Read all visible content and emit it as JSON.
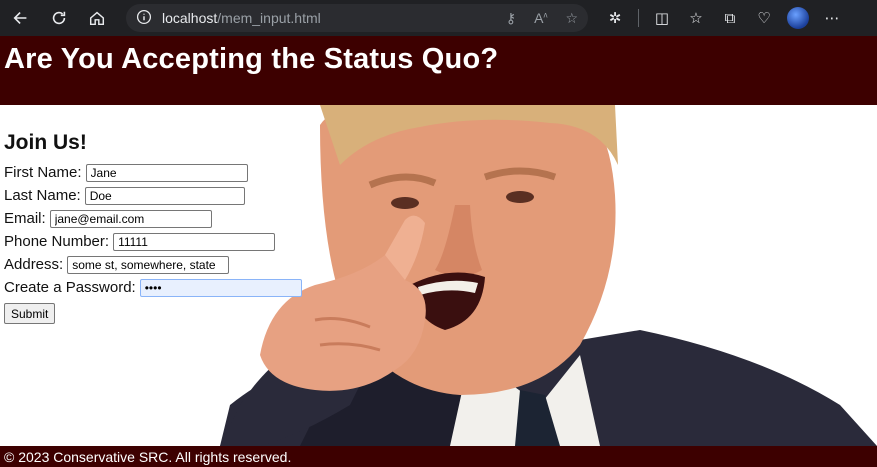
{
  "browser": {
    "url_host": "localhost",
    "url_path": "/mem_input.html",
    "icons": [
      "back-icon",
      "refresh-icon",
      "home-icon",
      "info-icon",
      "key-icon",
      "read-aloud-icon",
      "favorite-star-icon",
      "extensions-icon",
      "split-screen-icon",
      "favorites-icon",
      "collections-icon",
      "health-icon",
      "profile-avatar",
      "more-icon"
    ]
  },
  "header": {
    "title": "Are You Accepting the Status Quo?"
  },
  "form": {
    "heading": "Join Us!",
    "fields": {
      "first_name": {
        "label": "First Name:",
        "value": "Jane"
      },
      "last_name": {
        "label": "Last Name:",
        "value": "Doe"
      },
      "email": {
        "label": "Email:",
        "value": "jane@email.com"
      },
      "phone": {
        "label": "Phone Number:",
        "value": "11111"
      },
      "address": {
        "label": "Address:",
        "value": "some st, somewhere, state"
      },
      "password": {
        "label": "Create a Password:",
        "value": "••••"
      }
    },
    "submit_label": "Submit"
  },
  "footer": {
    "text": "© 2023 Conservative SRC. All rights reserved."
  },
  "colors": {
    "banner": "#3d0000",
    "browser_chrome": "#202124"
  }
}
